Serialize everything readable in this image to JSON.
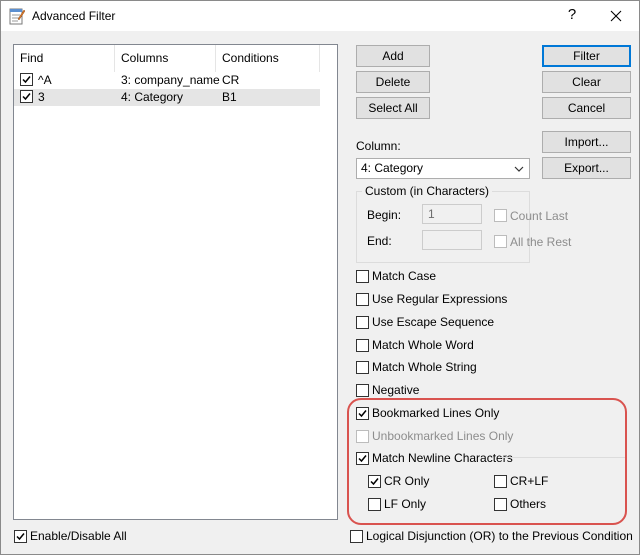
{
  "window": {
    "title": "Advanced Filter",
    "help_label": "?",
    "close_label": "✕"
  },
  "list": {
    "columns": [
      "Find",
      "Columns",
      "Conditions"
    ],
    "rows": [
      {
        "checked": true,
        "find": "^A",
        "column": "3: company_name",
        "condition": "CR"
      },
      {
        "checked": true,
        "find": "3",
        "column": "4: Category",
        "condition": "B1"
      }
    ]
  },
  "buttons": {
    "add": "Add",
    "delete": "Delete",
    "select_all": "Select All",
    "filter": "Filter",
    "clear": "Clear",
    "cancel": "Cancel",
    "import": "Import...",
    "export": "Export..."
  },
  "column": {
    "label": "Column:",
    "value": "4: Category"
  },
  "custom": {
    "legend": "Custom (in Characters)",
    "begin_label": "Begin:",
    "begin_value": "1",
    "end_label": "End:",
    "end_value": "",
    "count_last": "Count Last",
    "all_the_rest": "All the Rest"
  },
  "options": {
    "match_case": "Match Case",
    "regex": "Use Regular Expressions",
    "escape": "Use Escape Sequence",
    "whole_word": "Match Whole Word",
    "whole_string": "Match Whole String",
    "negative": "Negative",
    "bookmarked": "Bookmarked Lines Only",
    "unbookmarked": "Unbookmarked Lines Only",
    "newline": "Match Newline Characters",
    "cr_only": "CR Only",
    "crlf": "CR+LF",
    "lf_only": "LF Only",
    "others": "Others"
  },
  "footer": {
    "enable_all": "Enable/Disable All",
    "logical_or": "Logical Disjunction (OR) to the Previous Condition"
  },
  "colors": {
    "highlight": "#d9534f",
    "accent": "#0078d7"
  }
}
